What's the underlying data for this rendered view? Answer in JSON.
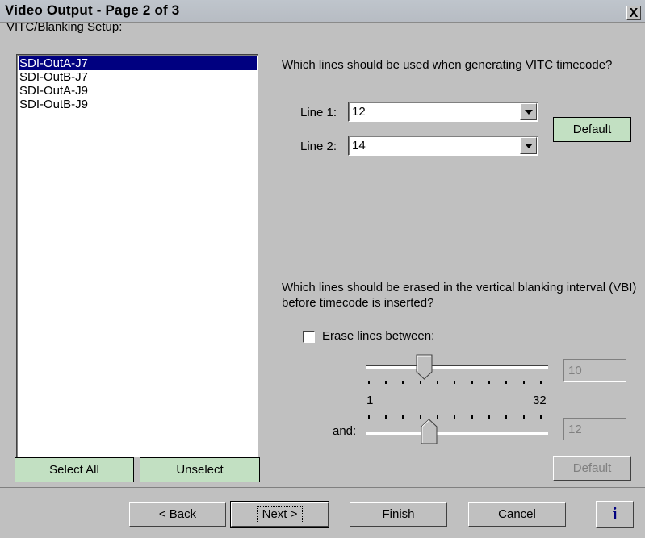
{
  "window": {
    "title": "Video Output - Page 2 of 3",
    "close_label": "X"
  },
  "group_label": "VITC/Blanking Setup:",
  "outputs": [
    {
      "label": "SDI-OutA-J7",
      "selected": true
    },
    {
      "label": "SDI-OutB-J7",
      "selected": false
    },
    {
      "label": "SDI-OutA-J9",
      "selected": false
    },
    {
      "label": "SDI-OutB-J9",
      "selected": false
    }
  ],
  "list_buttons": {
    "select_all": "Select All",
    "unselect": "Unselect"
  },
  "vitc": {
    "question": "Which lines should be used when generating VITC timecode?",
    "line1_label": "Line 1:",
    "line1_value": "12",
    "line2_label": "Line 2:",
    "line2_value": "14",
    "default_label": "Default"
  },
  "vbi": {
    "question": "Which lines should be erased in the vertical blanking interval (VBI) before timecode is inserted?",
    "checkbox_label": "Erase lines between:",
    "checked": false,
    "slider_min_label": "1",
    "slider_max_label": "32",
    "slider1_value": "10",
    "and_label": "and:",
    "slider2_value": "12",
    "default_label": "Default"
  },
  "footer": {
    "back_prefix": "< ",
    "back_key": "B",
    "back_rest": "ack",
    "next_key": "N",
    "next_rest": "ext >",
    "finish_key": "F",
    "finish_rest": "inish",
    "cancel_key": "C",
    "cancel_rest": "ancel",
    "info_label": "i"
  },
  "colors": {
    "selection": "#000080",
    "button_green": "#c2e0c2",
    "dialog_face": "#c0c0c0",
    "info_blue": "#000080"
  }
}
